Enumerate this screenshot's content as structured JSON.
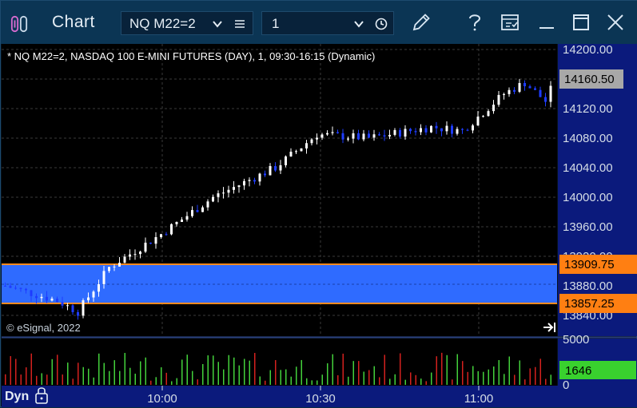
{
  "window": {
    "title": "Chart",
    "symbol": "NQ M22=2",
    "interval": "1",
    "icons": [
      "app-icon",
      "chevron-down-icon",
      "list-icon",
      "chevron-down-icon",
      "clock-icon",
      "pencil-icon",
      "help-icon",
      "save-icon",
      "minimize-icon",
      "maximize-icon",
      "close-icon"
    ]
  },
  "chart": {
    "info": "* NQ M22=2, NASDAQ 100 E-MINI FUTURES (DAY), 1, 09:30-16:15 (Dynamic)",
    "copyright": "© eSignal, 2022",
    "mode": "Dyn",
    "last_price": "14160.50",
    "zone_top": "13909.75",
    "zone_bottom": "13857.25",
    "volume_max_label": "5000",
    "volume_zero_label": "0",
    "last_volume": "1646",
    "colors": {
      "up": "#ffffff",
      "down": "#1e3cff",
      "zone_fill": "#2f6bff",
      "zone_border": "#ff8a1e",
      "volume_up": "#43d13b",
      "volume_down": "#d4211e",
      "axis_bg": "#0a1a7a"
    }
  },
  "chart_data": {
    "type": "candlestick",
    "price_axis": {
      "ticks": [
        "14200.00",
        "14160.00",
        "14120.00",
        "14080.00",
        "14040.00",
        "14000.00",
        "13960.00",
        "13920.00",
        "13880.00",
        "13840.00"
      ],
      "ylim": [
        13840,
        14200
      ]
    },
    "time_axis": {
      "ticks": [
        "10:00",
        "10:30",
        "11:00"
      ]
    },
    "volume_axis": {
      "ticks": [
        "5000",
        "0"
      ],
      "ylim": [
        0,
        5000
      ]
    },
    "candles_summary": {
      "start_close": 13880,
      "low": 13835,
      "high": 14180,
      "end_close": 14160.5
    }
  }
}
